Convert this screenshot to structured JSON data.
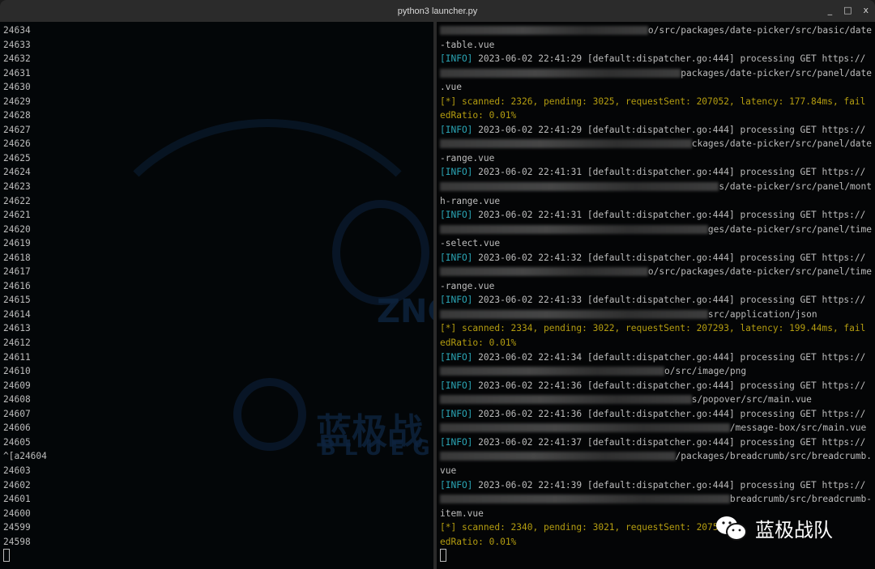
{
  "window": {
    "title": "python3 launcher.py",
    "controls": [
      "_",
      "□",
      "x"
    ]
  },
  "left_pane": {
    "lines": [
      "24634",
      "24633",
      "24632",
      "24631",
      "24630",
      "24629",
      "24628",
      "24627",
      "24626",
      "24625",
      "24624",
      "24623",
      "24622",
      "24621",
      "24620",
      "24619",
      "24618",
      "24617",
      "24616",
      "24615",
      "24614",
      "24613",
      "24612",
      "24611",
      "24610",
      "24609",
      "24608",
      "24607",
      "24606",
      "24605",
      "^[a24604",
      "24603",
      "24602",
      "24601",
      "24600",
      "24599",
      "24598"
    ]
  },
  "right_pane": {
    "lines": [
      {
        "blur": true,
        "text": "o/src/packages/date-picker/src/basic/date"
      },
      {
        "text": "-table.vue"
      },
      {
        "tag": "[INFO]",
        "text": " 2023-06-02 22:41:29 [default:dispatcher.go:444] processing GET https://"
      },
      {
        "blur": true,
        "text": "packages/date-picker/src/panel/date"
      },
      {
        "text": ".vue"
      },
      {
        "stat": "[*] scanned: 2326, pending: 3025, requestSent: 207052, latency: 177.84ms, fail"
      },
      {
        "stat": "edRatio: 0.01%"
      },
      {
        "tag": "[INFO]",
        "text": " 2023-06-02 22:41:29 [default:dispatcher.go:444] processing GET https://"
      },
      {
        "blur": true,
        "text": "ckages/date-picker/src/panel/date"
      },
      {
        "text": "-range.vue"
      },
      {
        "tag": "[INFO]",
        "text": " 2023-06-02 22:41:31 [default:dispatcher.go:444] processing GET https://"
      },
      {
        "blur": true,
        "text": "s/date-picker/src/panel/mont"
      },
      {
        "text": "h-range.vue"
      },
      {
        "tag": "[INFO]",
        "text": " 2023-06-02 22:41:31 [default:dispatcher.go:444] processing GET https://"
      },
      {
        "blur": true,
        "text": "ges/date-picker/src/panel/time"
      },
      {
        "text": "-select.vue"
      },
      {
        "tag": "[INFO]",
        "text": " 2023-06-02 22:41:32 [default:dispatcher.go:444] processing GET https://"
      },
      {
        "blur": true,
        "text": "o/src/packages/date-picker/src/panel/time"
      },
      {
        "text": "-range.vue"
      },
      {
        "tag": "[INFO]",
        "text": " 2023-06-02 22:41:33 [default:dispatcher.go:444] processing GET https://"
      },
      {
        "blur": true,
        "text": "src/application/json          "
      },
      {
        "stat": "[*] scanned: 2334, pending: 3022, requestSent: 207293, latency: 199.44ms, fail"
      },
      {
        "stat": "edRatio: 0.01%"
      },
      {
        "tag": "[INFO]",
        "text": " 2023-06-02 22:41:34 [default:dispatcher.go:444] processing GET https://"
      },
      {
        "blur": true,
        "text": "o/src/image/png                       "
      },
      {
        "tag": "[INFO]",
        "text": " 2023-06-02 22:41:36 [default:dispatcher.go:444] processing GET https://"
      },
      {
        "blur": true,
        "text": "s/popover/src/main.vue           "
      },
      {
        "tag": "[INFO]",
        "text": " 2023-06-02 22:41:36 [default:dispatcher.go:444] processing GET https://"
      },
      {
        "blur": true,
        "text": "/message-box/src/main.vue "
      },
      {
        "tag": "[INFO]",
        "text": " 2023-06-02 22:41:37 [default:dispatcher.go:444] processing GET https://"
      },
      {
        "blur": true,
        "text": "/packages/breadcrumb/src/breadcrumb."
      },
      {
        "text": "vue"
      },
      {
        "tag": "[INFO]",
        "text": " 2023-06-02 22:41:39 [default:dispatcher.go:444] processing GET https://"
      },
      {
        "blur": true,
        "text": "breadcrumb/src/breadcrumb-"
      },
      {
        "text": "item.vue"
      },
      {
        "stat": "[*] scanned: 2340, pending: 3021, requestSent: 2075"
      },
      {
        "stat": "edRatio: 0.01%"
      }
    ]
  },
  "watermark": {
    "logo_text": "ZNCK",
    "cn": "蓝极战",
    "en": "BLUEG"
  },
  "overlay": {
    "icon": "wechat-icon",
    "text": "蓝极战队"
  },
  "colors": {
    "info": "#2aa5b5",
    "stat": "#b49d10",
    "text": "#bcbcbc"
  }
}
